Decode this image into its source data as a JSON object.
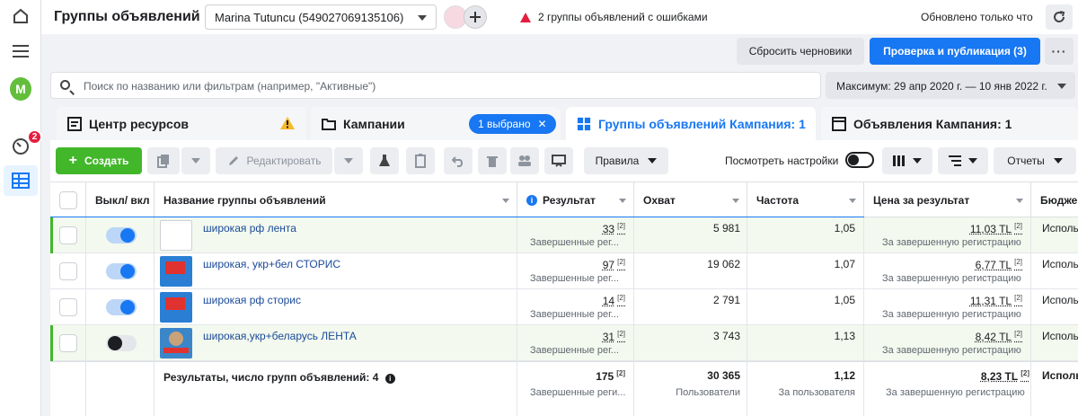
{
  "header": {
    "title": "Группы объявлений",
    "account": "Marina Tutuncu (549027069135106)",
    "errors": "2 группы объявлений с ошибками",
    "updated": "Обновлено только что"
  },
  "actions": {
    "reset": "Сбросить черновики",
    "publish": "Проверка и публикация (3)",
    "more": "···"
  },
  "search": {
    "placeholder": "Поиск по названию или фильтрам (например, \"Активные\")",
    "value": ""
  },
  "daterange": "Максимум: 29 апр 2020 г. — 10 янв 2022 г.",
  "rail": {
    "avatar": "M",
    "notifications": "2"
  },
  "tabs": [
    {
      "label": "Центр ресурсов"
    },
    {
      "label": "Кампании",
      "pill": "1 выбрано"
    },
    {
      "label": "Группы объявлений Кампания: 1"
    },
    {
      "label": "Объявления Кампания: 1"
    }
  ],
  "toolbar": {
    "create": "Создать",
    "edit": "Редактировать",
    "rules": "Правила",
    "view_settings": "Посмотреть настройки",
    "reports": "Отчеты"
  },
  "columns": {
    "onoff": "Выкл/ вкл",
    "name": "Название группы объявлений",
    "result": "Результат",
    "reach": "Охват",
    "frequency": "Частота",
    "cost": "Цена за результат",
    "budget": "Бюдже"
  },
  "rows": [
    {
      "name": "широкая рф лента",
      "on": true,
      "result": "33",
      "result_note": "[2]",
      "result_sub": "Завершенные рег...",
      "reach": "5 981",
      "frequency": "1,05",
      "cost": "11,03 TL",
      "cost_note": "[2]",
      "cost_sub": "За завершенную регистрацию",
      "budget": "Исполь"
    },
    {
      "name": "широкая, укр+бел СТОРИС",
      "on": true,
      "result": "97",
      "result_note": "[2]",
      "result_sub": "Завершенные рег...",
      "reach": "19 062",
      "frequency": "1,07",
      "cost": "6,77 TL",
      "cost_note": "[2]",
      "cost_sub": "За завершенную регистрацию",
      "budget": "Исполь"
    },
    {
      "name": "широкая рф сторис",
      "on": true,
      "result": "14",
      "result_note": "[2]",
      "result_sub": "Завершенные рег...",
      "reach": "2 791",
      "frequency": "1,05",
      "cost": "11,31 TL",
      "cost_note": "[2]",
      "cost_sub": "За завершенную регистрацию",
      "budget": "Исполь"
    },
    {
      "name": "широкая,укр+беларусь ЛЕНТА",
      "on": false,
      "result": "31",
      "result_note": "[2]",
      "result_sub": "Завершенные рег...",
      "reach": "3 743",
      "frequency": "1,13",
      "cost": "8,42 TL",
      "cost_note": "[2]",
      "cost_sub": "За завершенную регистрацию",
      "budget": "Исполь"
    }
  ],
  "footer": {
    "label": "Результаты, число групп объявлений: 4",
    "result": "175",
    "result_note": "[2]",
    "result_sub": "Завершенные реги...",
    "reach": "30 365",
    "reach_sub": "Пользователи",
    "frequency": "1,12",
    "frequency_sub": "За пользователя",
    "cost": "8,23 TL",
    "cost_note": "[2]",
    "cost_sub": "За завершенную регистрацию",
    "budget": "Исполь"
  },
  "colors": {
    "accent": "#1877f2",
    "create": "#42b72a",
    "error": "#e41e3f",
    "warning": "#f7b928"
  }
}
